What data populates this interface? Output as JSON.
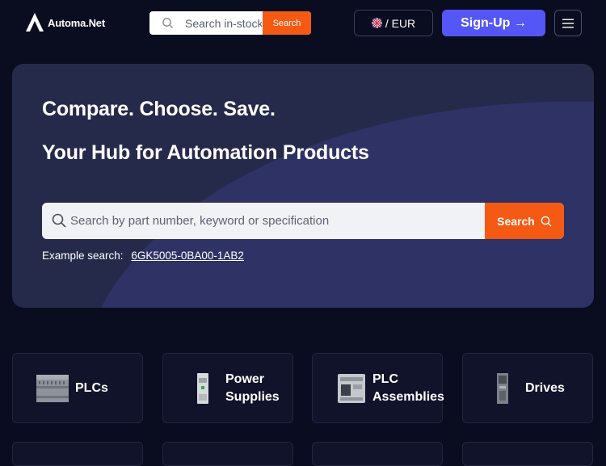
{
  "header": {
    "brand": "Automa.Net",
    "search_placeholder": "Search in-stock",
    "search_button": "Search",
    "currency": "/ EUR",
    "signup": "Sign-Up →"
  },
  "hero": {
    "headline": "Compare. Choose. Save.",
    "subheadline": "Your Hub for Automation Products",
    "search_placeholder": "Search by part number, keyword or specification",
    "search_button": "Search",
    "example_label": "Example search:",
    "example_value": "6GK5005-0BA00-1AB2"
  },
  "categories": [
    {
      "label": "PLCs",
      "icon": "plc-icon"
    },
    {
      "label": "Power Supplies",
      "icon": "power-supply-icon"
    },
    {
      "label": "PLC Assemblies",
      "icon": "plc-assembly-icon"
    },
    {
      "label": "Drives",
      "icon": "drive-icon"
    }
  ],
  "colors": {
    "accent": "#f45a14",
    "primary": "#5457f5",
    "background": "#0a0c1f",
    "hero": "#262a4a"
  }
}
